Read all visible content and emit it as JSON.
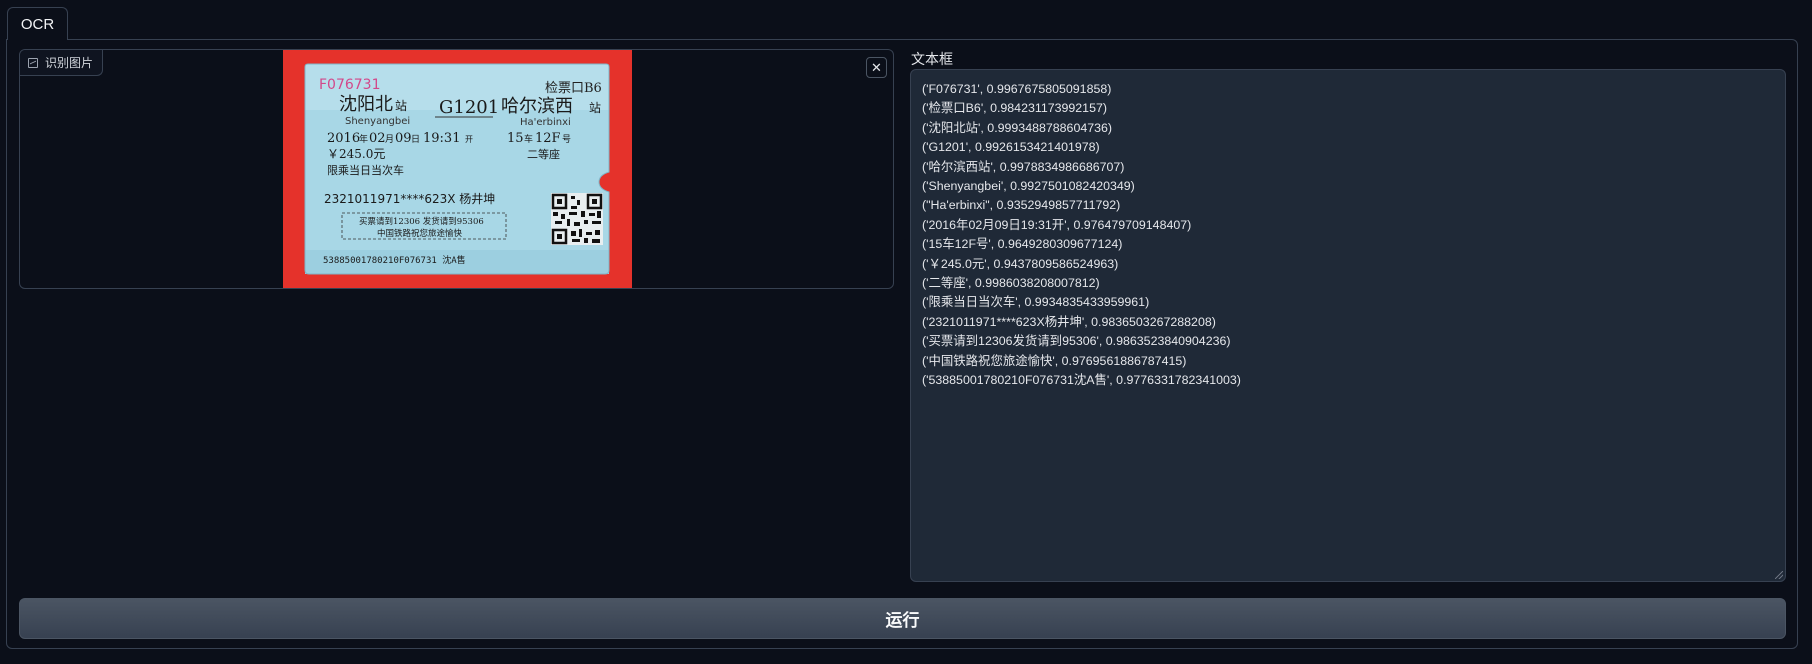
{
  "tabs": [
    {
      "label": "OCR"
    }
  ],
  "image_input": {
    "label": "识别图片",
    "clear_icon": "close-icon",
    "ticket": {
      "serial": "F076731",
      "gate": "检票口B6",
      "from_station": "沈阳北",
      "station_suffix": "站",
      "from_pinyin": "Shenyangbei",
      "train_no": "G1201",
      "to_station": "哈尔滨西",
      "to_pinyin": "Ha'erbinxi",
      "date": "2016年02月09日19:31开",
      "date_parts": [
        "2016",
        "年",
        "02",
        "月",
        "09",
        "日",
        "19:31",
        "开"
      ],
      "seat_parts": [
        "15",
        "车",
        "12F",
        "号"
      ],
      "price": "￥245.0元",
      "seat_class": "二等座",
      "restriction": "限乘当日当次车",
      "id_name": "2321011971****623X 杨井坤",
      "notice1": "买票请到12306 发货请到95306",
      "notice2": "中国铁路祝您旅途愉快",
      "barcode": "53885001780210F076731 沈A售"
    }
  },
  "output": {
    "label": "文本框",
    "lines": [
      "('F076731', 0.9967675805091858)",
      "('检票口B6', 0.984231173992157)",
      "('沈阳北站', 0.9993488788604736)",
      "('G1201', 0.9926153421401978)",
      "('哈尔滨西站', 0.9978834986686707)",
      "('Shenyangbei', 0.9927501082420349)",
      "(\"Ha'erbinxi\", 0.9352949857711792)",
      "('2016年02月09日19:31开', 0.976479709148407)",
      "('15车12F号', 0.9649280309677124)",
      "('￥245.0元', 0.9437809586524963)",
      "('二等座', 0.9986038208007812)",
      "('限乘当日当次车', 0.9934835433959961)",
      "('2321011971****623X杨井坤', 0.9836503267288208)",
      "('买票请到12306发货请到95306', 0.9863523840904236)",
      "('中国铁路祝您旅途愉快', 0.9769561886787415)",
      "('53885001780210F076731沈A售', 0.9776331782341003)"
    ]
  },
  "run_button": {
    "label": "运行"
  },
  "colors": {
    "background": "#0b0f19",
    "border": "#374151",
    "textbox_bg": "#1f2937",
    "button_bg": "#4b5563",
    "ticket_blue": "#a9d8e8",
    "ticket_red": "#e5322b"
  }
}
